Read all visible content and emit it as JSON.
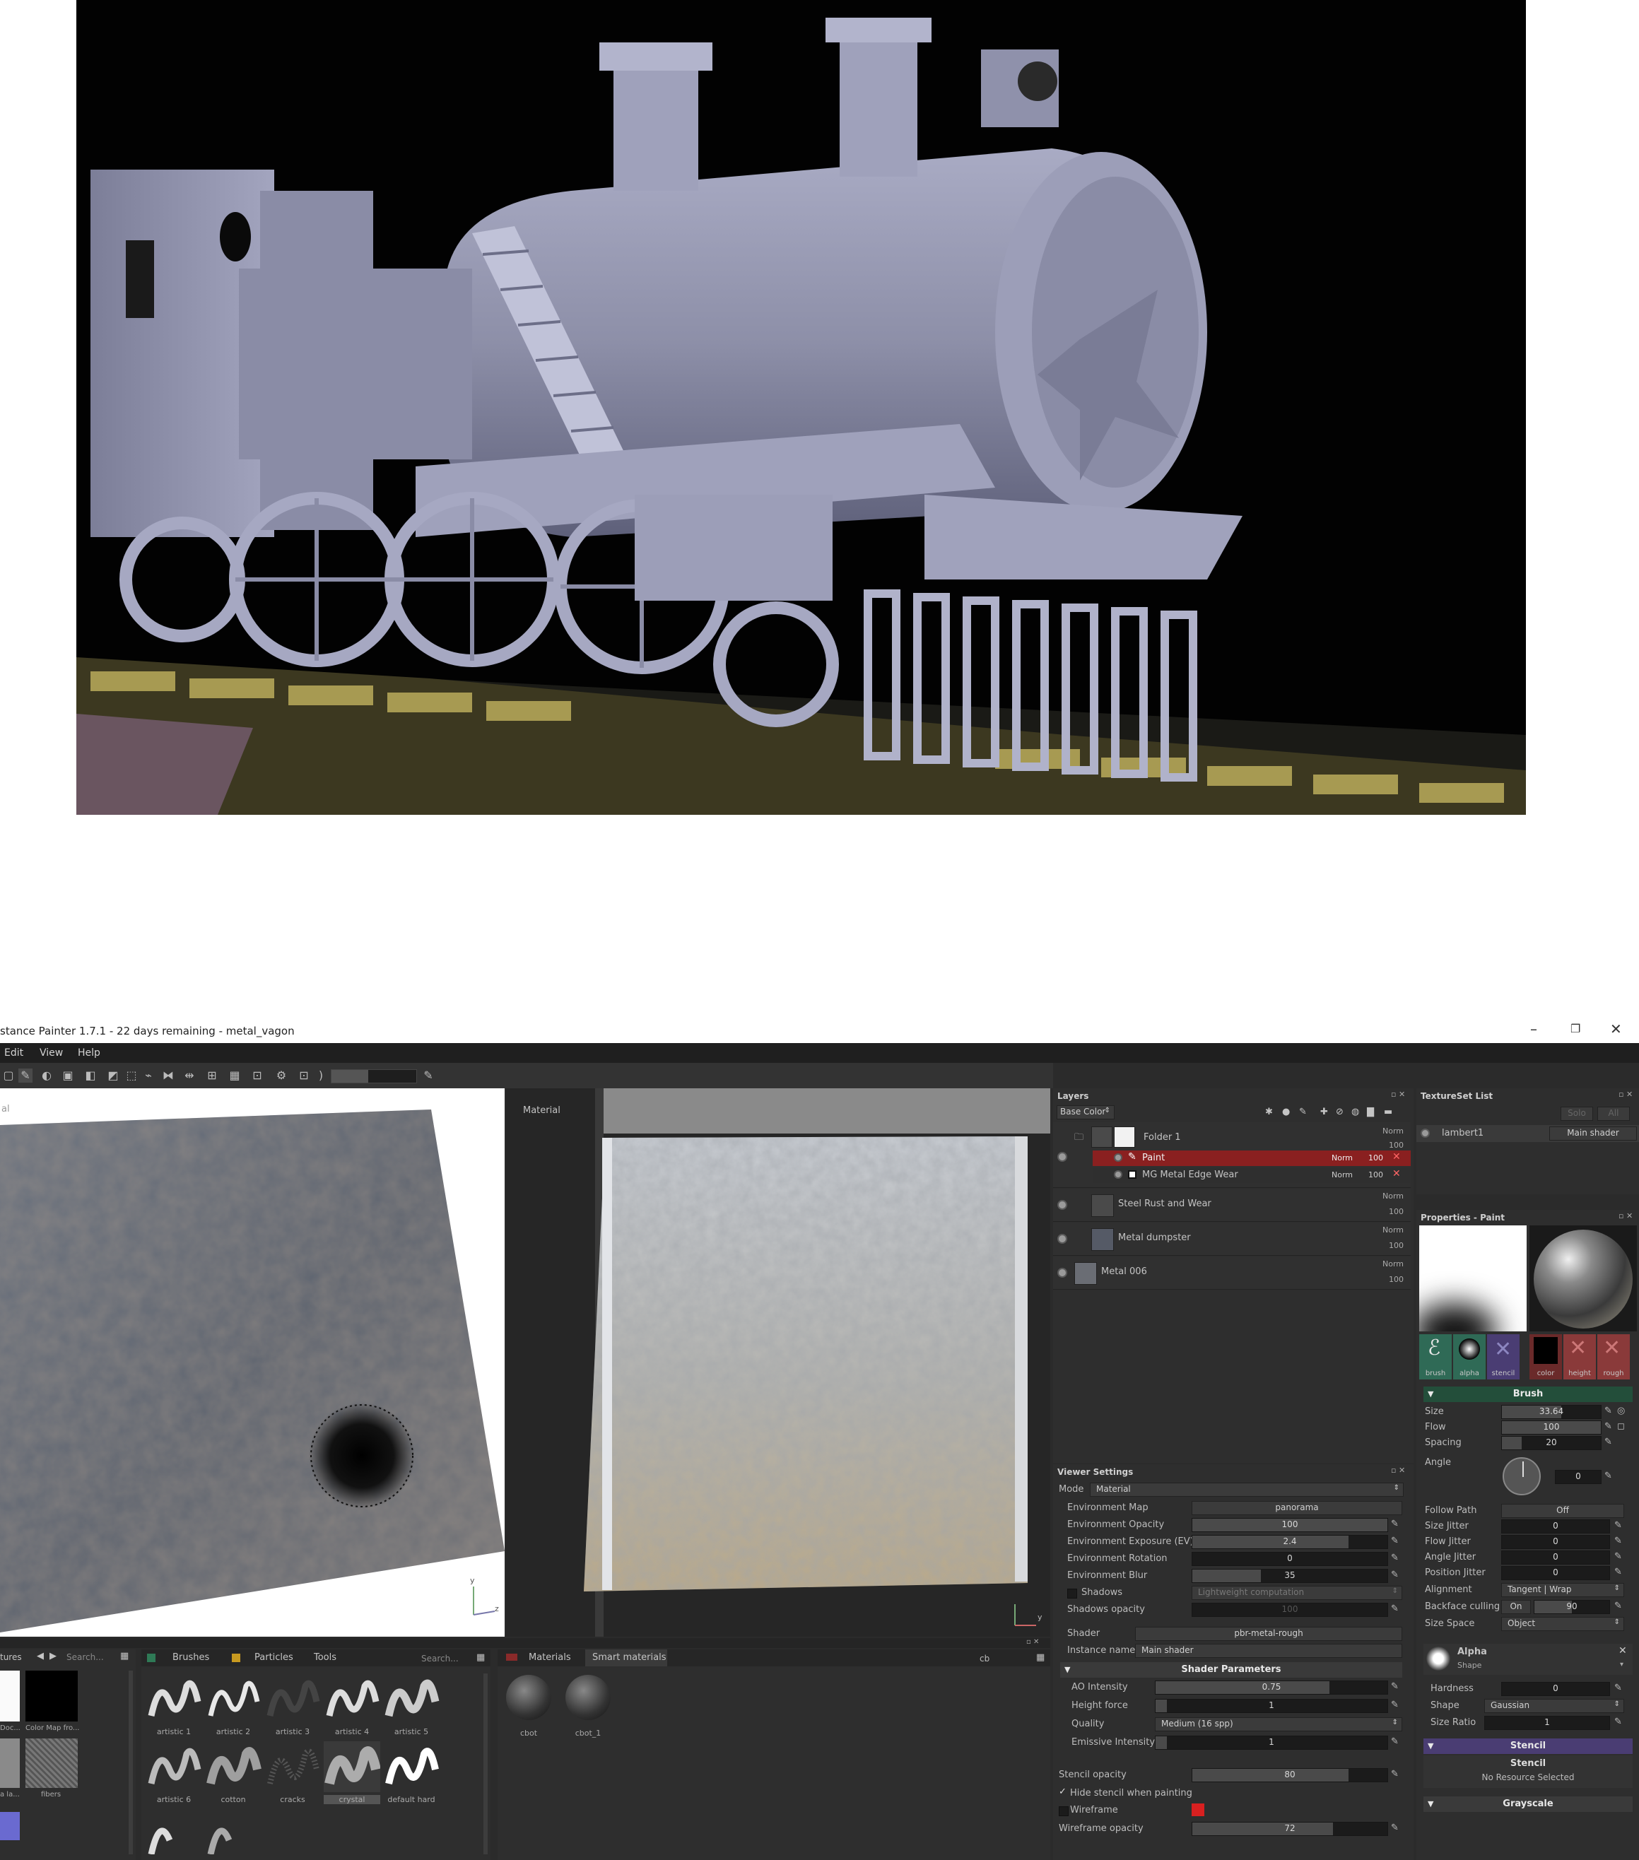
{
  "app": {
    "title": "stance Painter 1.7.1 - 22 days remaining - metal_vagon",
    "window_controls": [
      "–",
      "❐",
      "✕"
    ],
    "menu": [
      "Edit",
      "View",
      "Help"
    ],
    "toolbar_field": "",
    "colors": {
      "bg": "#2b2b2b",
      "selected_layer": "#8a2020",
      "brush_section": "#234e3a",
      "stencil_section": "#4a3d73"
    }
  },
  "viewport3d": {
    "label": "al",
    "axis_y": "y",
    "axis_z": "z"
  },
  "viewport2d": {
    "label": "Material",
    "axis": "y"
  },
  "layers": {
    "title": "Layers",
    "channel": "Base Color",
    "items": [
      {
        "name": "Folder 1",
        "blend": "Norm",
        "opacity": "100"
      },
      {
        "name": "Paint",
        "blend": "Norm",
        "opacity": "100"
      },
      {
        "name": "MG Metal Edge Wear",
        "blend": "Norm",
        "opacity": "100"
      },
      {
        "name": "Steel Rust and Wear",
        "blend": "Norm",
        "opacity": "100"
      },
      {
        "name": "Metal dumpster",
        "blend": "Norm",
        "opacity": "100"
      },
      {
        "name": "Metal 006",
        "blend": "Norm",
        "opacity": "100"
      }
    ]
  },
  "textureset": {
    "title": "TextureSet List",
    "btn1": "Solo",
    "btn2": "All",
    "item": "lambert1",
    "shader": "Main shader"
  },
  "properties": {
    "title": "Properties - Paint",
    "tiles": [
      "brush",
      "alpha",
      "stencil",
      "color",
      "height",
      "rough"
    ],
    "brush_header": "Brush",
    "size_label": "Size",
    "size": "33.64",
    "flow_label": "Flow",
    "flow": "100",
    "spacing_label": "Spacing",
    "spacing": "20",
    "angle_label": "Angle",
    "angle": "0",
    "follow_path_label": "Follow Path",
    "follow_path": "Off",
    "size_jitter_label": "Size Jitter",
    "size_jitter": "0",
    "flow_jitter_label": "Flow Jitter",
    "flow_jitter": "0",
    "angle_jitter_label": "Angle Jitter",
    "angle_jitter": "0",
    "position_jitter_label": "Position Jitter",
    "position_jitter": "0",
    "alignment_label": "Alignment",
    "alignment": "Tangent | Wrap",
    "backface_label": "Backface culling",
    "backface_toggle": "On",
    "backface_value": "90",
    "size_space_label": "Size Space",
    "size_space": "Object",
    "alpha_label": "Alpha",
    "alpha_sub": "Shape",
    "hardness_label": "Hardness",
    "hardness": "0",
    "shape_label": "Shape",
    "shape": "Gaussian",
    "size_ratio_label": "Size Ratio",
    "size_ratio": "1",
    "stencil_header": "Stencil",
    "stencil_label": "Stencil",
    "stencil_value": "No Resource Selected",
    "grayscale_header": "Grayscale"
  },
  "viewer": {
    "title": "Viewer Settings",
    "mode_label": "Mode",
    "mode": "Material",
    "env_map_label": "Environment Map",
    "env_map": "panorama",
    "env_opacity_label": "Environment Opacity",
    "env_opacity": "100",
    "env_opacity_pct": 100,
    "env_exposure_label": "Environment Exposure (EV)",
    "env_exposure": "2.4",
    "env_exposure_pct": 80,
    "env_rotation_label": "Environment Rotation",
    "env_rotation": "0",
    "env_rotation_pct": 0,
    "env_blur_label": "Environment Blur",
    "env_blur": "35",
    "env_blur_pct": 35,
    "shadows_label": "Shadows",
    "shadows": "Lightweight computation",
    "shadows_opacity_label": "Shadows opacity",
    "shadows_opacity": "100",
    "shader_label": "Shader",
    "shader": "pbr-metal-rough",
    "instance_label": "Instance name",
    "instance": "Main shader",
    "shader_params": "Shader Parameters",
    "ao_label": "AO Intensity",
    "ao": "0.75",
    "ao_pct": 75,
    "height_label": "Height force",
    "height": "1",
    "height_pct": 5,
    "quality_label": "Quality",
    "quality": "Medium (16 spp)",
    "emissive_label": "Emissive Intensity",
    "emissive": "1",
    "emissive_pct": 5,
    "stencil_opacity_label": "Stencil opacity",
    "stencil_opacity": "80",
    "stencil_opacity_pct": 80,
    "hide_stencil_label": "Hide stencil when painting",
    "wireframe_label": "Wireframe",
    "wireframe_opacity_label": "Wireframe opacity",
    "wireframe_opacity": "72",
    "wireframe_opacity_pct": 72
  },
  "shelf_textures": {
    "tab": "tures",
    "search": "Search...",
    "items": [
      "Doc...",
      "Color Map fro...",
      "a la...",
      "fibers"
    ]
  },
  "shelf_brushes": {
    "tabs": [
      "Brushes",
      "Particles",
      "Tools"
    ],
    "search": "Search...",
    "items": [
      "artistic 1",
      "artistic 2",
      "artistic 3",
      "artistic 4",
      "artistic 5",
      "artistic 6",
      "cotton",
      "cracks",
      "crystal",
      "default hard"
    ]
  },
  "shelf_materials": {
    "tabs": [
      "Materials",
      "Smart materials"
    ],
    "search": "cb",
    "items": [
      "cbot",
      "cbot_1"
    ]
  }
}
